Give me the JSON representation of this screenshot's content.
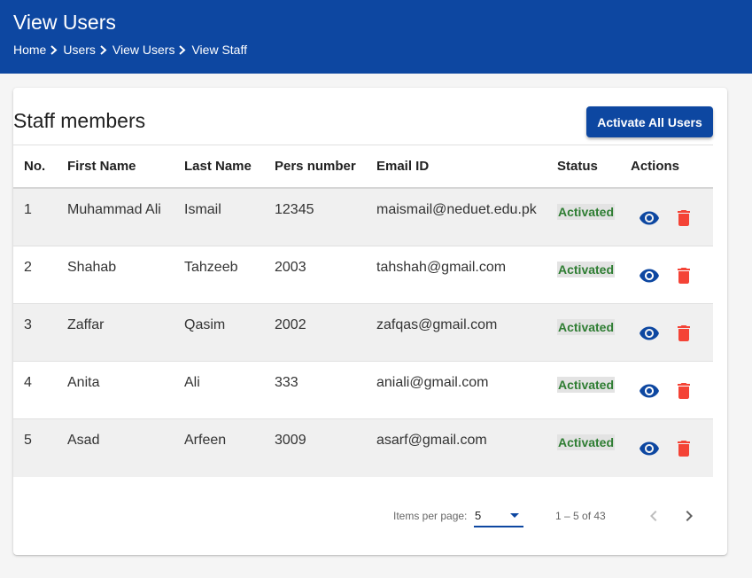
{
  "header": {
    "title": "View Users",
    "breadcrumb": [
      "Home",
      "Users",
      "View Users",
      "View Staff"
    ]
  },
  "card": {
    "title": "Staff members",
    "activate_button": "Activate All Users"
  },
  "table": {
    "columns": [
      "No.",
      "First Name",
      "Last Name",
      "Pers number",
      "Email ID",
      "Status",
      "Actions"
    ],
    "rows": [
      {
        "no": "1",
        "first": "Muhammad Ali",
        "last": "Ismail",
        "pers": "12345",
        "email": "maismail@neduet.edu.pk",
        "status": "Activated"
      },
      {
        "no": "2",
        "first": "Shahab",
        "last": "Tahzeeb",
        "pers": "2003",
        "email": "tahshah@gmail.com",
        "status": "Activated"
      },
      {
        "no": "3",
        "first": "Zaffar",
        "last": "Qasim",
        "pers": "2002",
        "email": "zafqas@gmail.com",
        "status": "Activated"
      },
      {
        "no": "4",
        "first": "Anita",
        "last": "Ali",
        "pers": "333",
        "email": "aniali@gmail.com",
        "status": "Activated"
      },
      {
        "no": "5",
        "first": "Asad",
        "last": "Arfeen",
        "pers": "3009",
        "email": "asarf@gmail.com",
        "status": "Activated"
      }
    ]
  },
  "paginator": {
    "items_per_page_label": "Items per page:",
    "items_per_page_value": "5",
    "range_label": "1 – 5 of 43"
  },
  "icons": {
    "view": "eye-icon",
    "delete": "trash-icon",
    "prev": "chevron-left-icon",
    "next": "chevron-right-icon",
    "dropdown": "caret-down-icon",
    "breadcrumb_sep": "chevron-right-icon"
  },
  "colors": {
    "primary": "#0d47a1",
    "status_active": "#2e7d32",
    "delete": "#f44336"
  }
}
